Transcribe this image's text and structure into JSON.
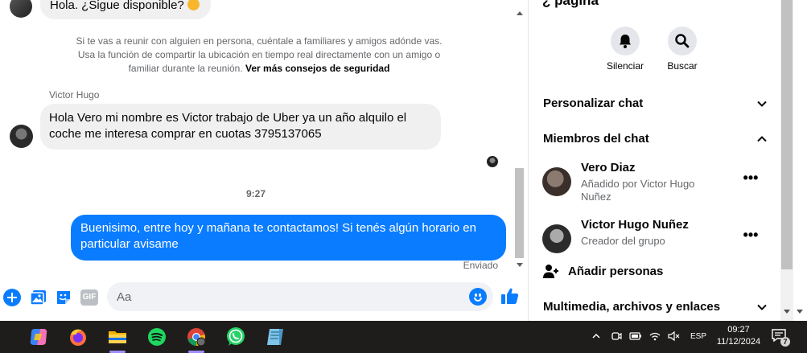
{
  "chat": {
    "first_message": "Hola. ¿Sigue disponible?",
    "safety_notice": "Si te vas a reunir con alguien en persona, cuéntale a familiares y amigos adónde vas. Usa la función de compartir la ubicación en tiempo real directamente con un amigo o familiar durante la reunión.",
    "safety_link": "Ver más consejos de seguridad",
    "sender_name": "Victor Hugo",
    "incoming_message": "Hola  Vero mi nombre es Victor trabajo de Uber ya un año alquilo el coche me interesa comprar en cuotas 3795137065",
    "time_separator": "9:27",
    "outgoing_message": "Buenisimo, entre hoy y mañana te contactamos! Si tenés algún horario en particular avisame",
    "sent_status": "Enviado"
  },
  "composer": {
    "placeholder": "Aa",
    "gif_label": "GIF",
    "icons": [
      "plus-icon",
      "gallery-icon",
      "sticker-icon",
      "gif-icon",
      "emoji-icon",
      "like-icon"
    ]
  },
  "info_panel": {
    "top_partial_title": "¿ página",
    "actions": {
      "mute": "Silenciar",
      "search": "Buscar"
    },
    "customize_chat": "Personalizar chat",
    "chat_members": "Miembros del chat",
    "members": [
      {
        "name": "Vero Diaz",
        "subtitle": "Añadido por Victor Hugo Nuñez"
      },
      {
        "name": "Victor Hugo Nuñez",
        "subtitle": "Creador del grupo"
      }
    ],
    "add_people": "Añadir personas",
    "media_files_links": "Multimedia, archivos y enlaces"
  },
  "taskbar": {
    "apps": [
      "copilot-icon",
      "firefox-icon",
      "file-explorer-icon",
      "spotify-icon",
      "chrome-icon",
      "whatsapp-icon",
      "notepad-icon"
    ],
    "language": "ESP",
    "time": "09:27",
    "date": "11/12/2024",
    "notification_count": "7"
  },
  "colors": {
    "accent": "#0a7cff",
    "bubble_in": "#f0f0f0",
    "taskbar": "#1f1d1b"
  }
}
